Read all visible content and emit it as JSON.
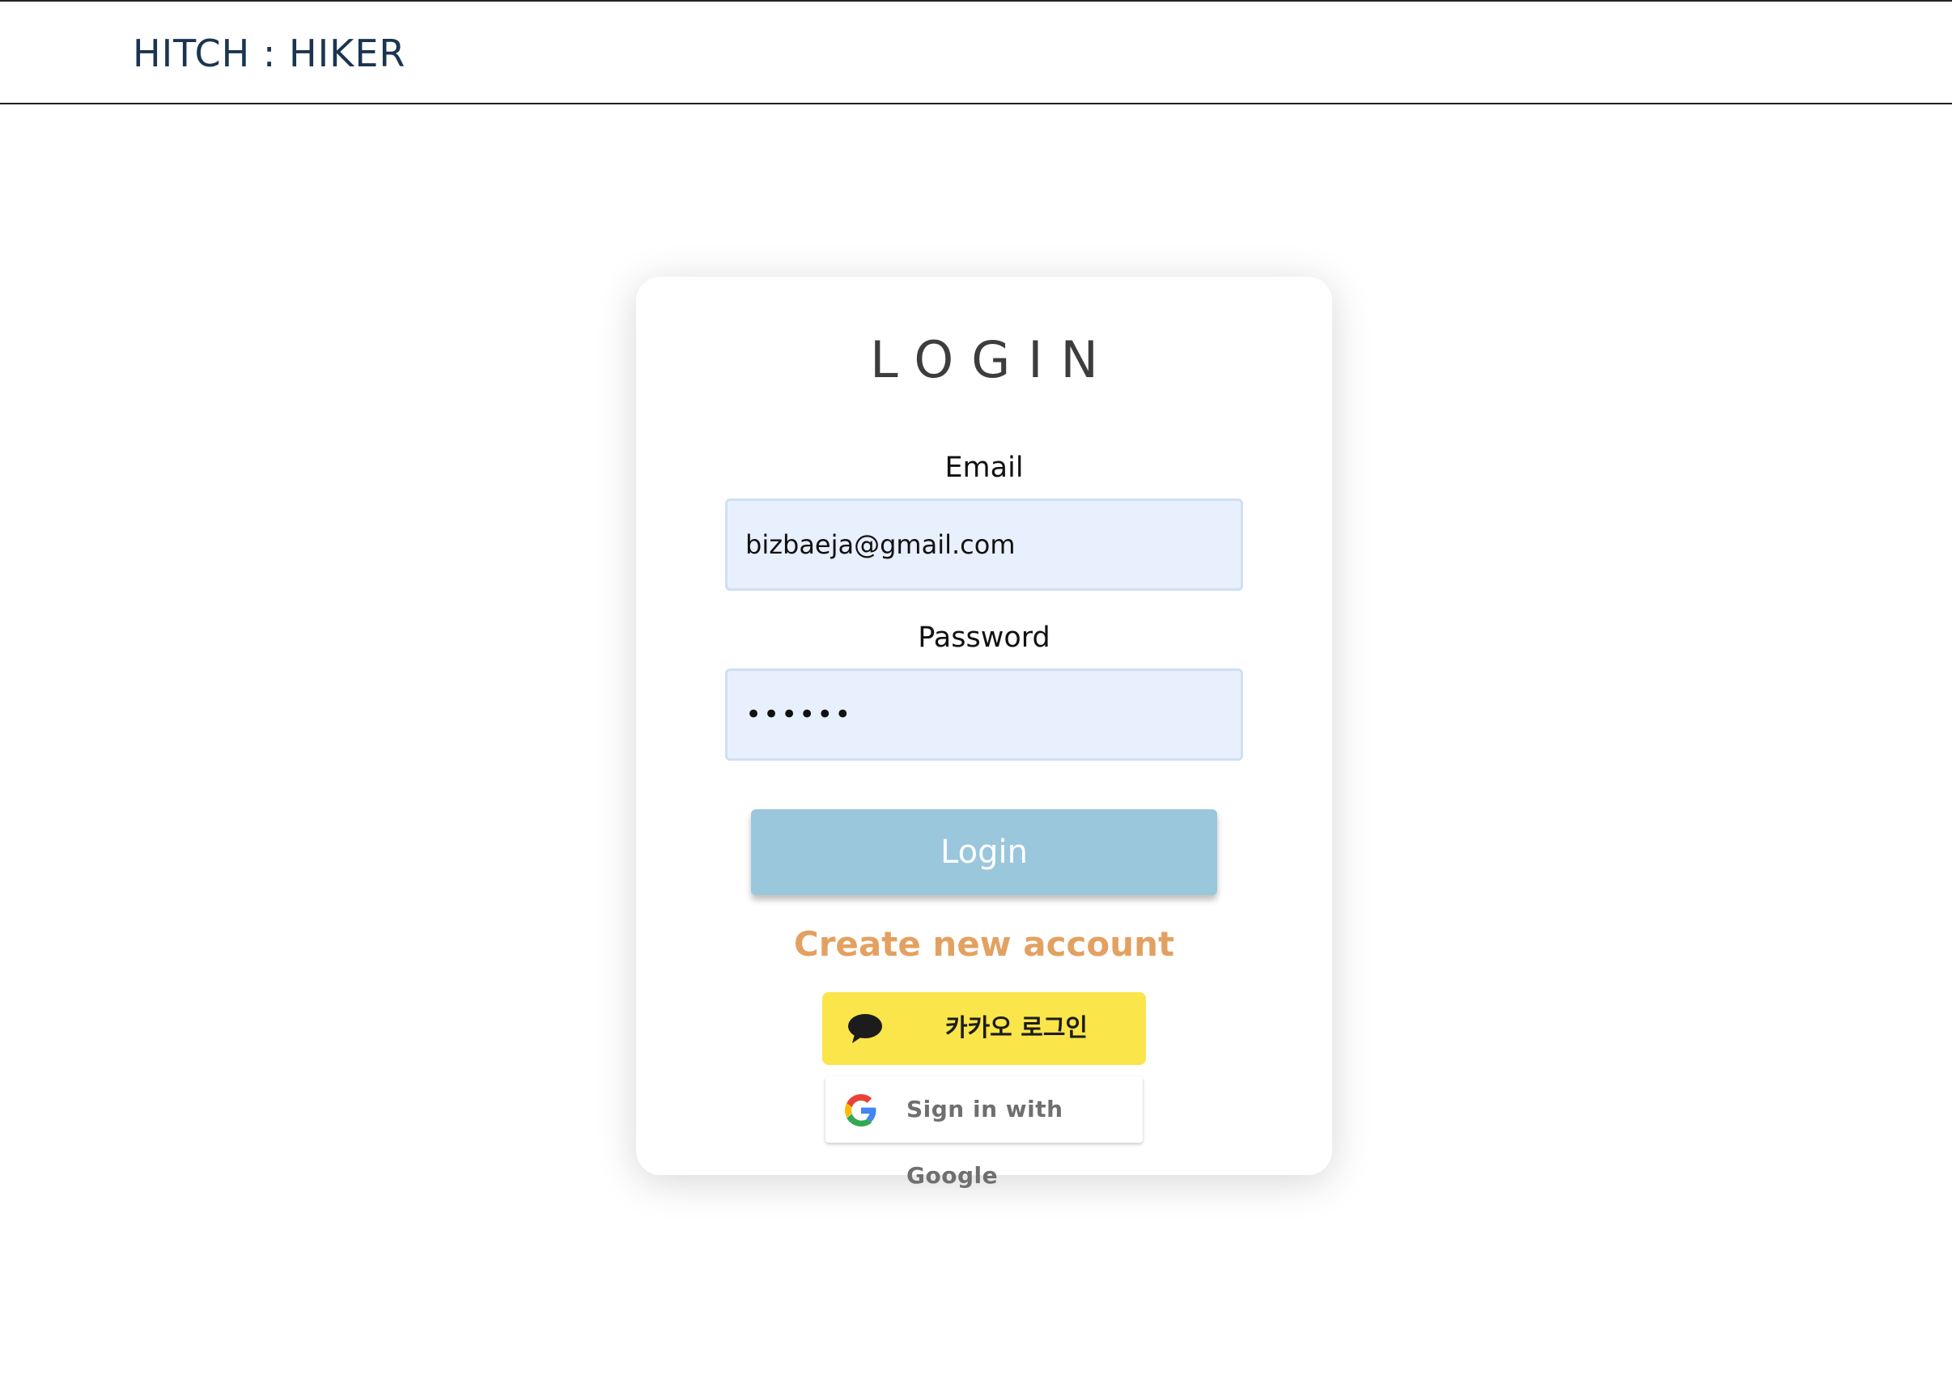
{
  "header": {
    "brand": "HITCH : HIKER"
  },
  "login_card": {
    "title": "LOGIN",
    "email": {
      "label": "Email",
      "value": "bizbaeja@gmail.com"
    },
    "password": {
      "label": "Password",
      "value": "••••••"
    },
    "login_button": "Login",
    "create_account_link": "Create new account",
    "kakao_button": {
      "label": "카카오 로그인",
      "icon": "chat-bubble-icon",
      "color": "#fae54a"
    },
    "google_button": {
      "label": "Sign in with Google",
      "icon": "google-g-icon"
    }
  },
  "colors": {
    "brand_text": "#1b3550",
    "login_button": "#9ac7dc",
    "create_link": "#e3a161",
    "input_background": "#e9f0fd"
  }
}
